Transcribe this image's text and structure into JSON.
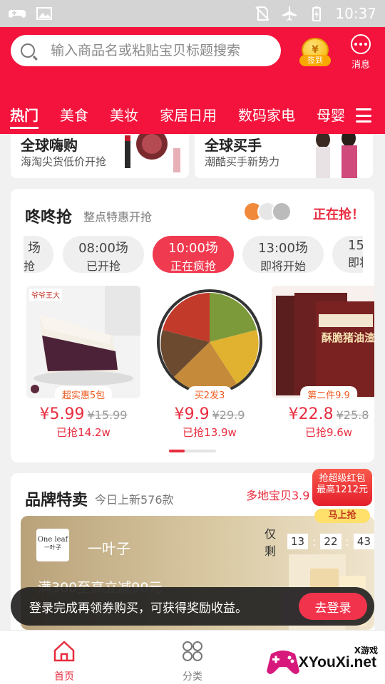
{
  "status_bar": {
    "time": "10:37"
  },
  "search": {
    "placeholder": "输入商品名或粘贴宝贝标题搜索"
  },
  "header": {
    "sign_label": "签到",
    "coin_symbol": "¥",
    "messages_label": "消息"
  },
  "tabs": [
    "热门",
    "美食",
    "美妆",
    "家居日用",
    "数码家电",
    "母婴"
  ],
  "promos": [
    {
      "title": "全球嗨购",
      "subtitle": "海淘尖货低价开抢"
    },
    {
      "title": "全球买手",
      "subtitle": "潮酷买手新势力"
    }
  ],
  "dongdong": {
    "title": "咚咚抢",
    "subtitle": "整点特惠开抢",
    "live_label": "正在抢！",
    "sessions": [
      {
        "time": "场",
        "state": "抢"
      },
      {
        "time": "08:00场",
        "state": "已开抢"
      },
      {
        "time": "10:00场",
        "state": "正在疯抢"
      },
      {
        "time": "13:00场",
        "state": "即将开始"
      },
      {
        "time": "15",
        "state": "即将"
      }
    ],
    "products": [
      {
        "tag": "超实惠5包",
        "price": "¥5.99",
        "original": "¥15.99",
        "sold": "已抢14.2w",
        "brand_text": "爷爷王大"
      },
      {
        "tag": "买2发3",
        "price": "¥9.9",
        "original": "¥29.9",
        "sold": "已抢13.9w"
      },
      {
        "tag": "第二件9.9",
        "price": "¥22.8",
        "original": "¥25.8",
        "sold": "已抢9.6w",
        "pack_text": "酥脆猪油渣"
      }
    ],
    "pager": {
      "current": 1,
      "total": 3
    }
  },
  "brand": {
    "title": "品牌特卖",
    "subtitle": "今日上新576款",
    "more": "多地宝贝3.9",
    "logo_text": "One leaf",
    "logo_subtext": "一叶子",
    "name": "一叶子",
    "offer": "满300至高立减90元",
    "countdown_label": "仅剩",
    "countdown": [
      "13",
      "22",
      "43"
    ]
  },
  "red_packet": {
    "line1": "抢超级红包",
    "line2": "最高1212元",
    "button": "马上抢"
  },
  "toast": {
    "text": "登录完成再领券购买，可获得奖励收益。",
    "button": "去登录"
  },
  "bottom_nav": [
    {
      "label": "首页"
    },
    {
      "label": "分类"
    }
  ],
  "watermark": {
    "small": "X游戏",
    "big": "XYouXi.net"
  },
  "colors": {
    "primary_red": "#f3133c",
    "price_red": "#e82d3f",
    "tag_orange": "#f05a20"
  }
}
